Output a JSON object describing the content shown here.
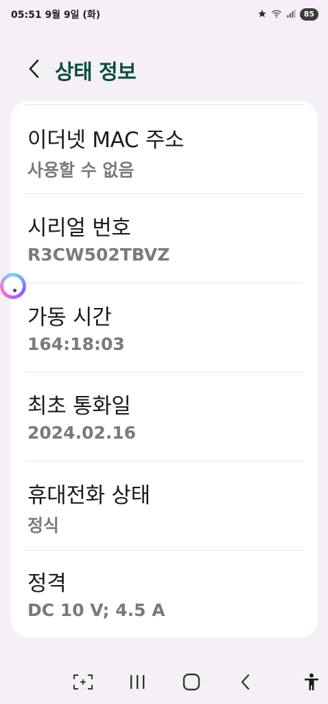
{
  "status_bar": {
    "time_date": "05:51  9월 9일 (화)",
    "battery": "85",
    "icons": [
      "star-icon",
      "wifi-icon",
      "signal-icon",
      "battery-icon"
    ]
  },
  "header": {
    "title": "상태 정보",
    "back_icon": "chevron-left-icon",
    "title_color": "#0b4d3c"
  },
  "rows": [
    {
      "label": "이더넷 MAC 주소",
      "value": "사용할 수 없음"
    },
    {
      "label": "시리얼 번호",
      "value": "R3CW502TBVZ"
    },
    {
      "label": "가동 시간",
      "value": "164:18:03"
    },
    {
      "label": "최초 통화일",
      "value": "2024.02.16"
    },
    {
      "label": "휴대전화 상태",
      "value": "정식"
    },
    {
      "label": "정격",
      "value": "DC 10 V; 4.5 A"
    }
  ],
  "nav": {
    "icons": [
      "screenshot-icon",
      "recents-icon",
      "home-icon",
      "back-icon",
      "accessibility-icon"
    ]
  }
}
